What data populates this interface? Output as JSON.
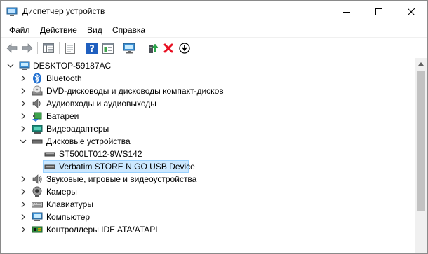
{
  "window": {
    "title": "Диспетчер устройств"
  },
  "menu": {
    "items": [
      {
        "label": "Файл"
      },
      {
        "label": "Действие"
      },
      {
        "label": "Вид"
      },
      {
        "label": "Справка"
      }
    ]
  },
  "toolbar": {
    "buttons": [
      {
        "icon": "back-arrow-icon"
      },
      {
        "icon": "forward-arrow-icon"
      },
      {
        "icon": "show-hide-console-tree-icon"
      },
      {
        "icon": "properties-icon"
      },
      {
        "icon": "help-icon"
      },
      {
        "icon": "action-pane-icon"
      },
      {
        "icon": "scan-hardware-icon"
      },
      {
        "icon": "update-driver-icon"
      },
      {
        "icon": "uninstall-device-icon"
      },
      {
        "icon": "disable-device-icon"
      }
    ]
  },
  "tree": {
    "root": {
      "label": "DESKTOP-59187AC",
      "expanded": true
    },
    "items": [
      {
        "label": "Bluetooth",
        "icon": "bluetooth-icon",
        "expanded": false,
        "level": 1
      },
      {
        "label": "DVD-дисководы и дисководы компакт-дисков",
        "icon": "dvd-drive-icon",
        "expanded": false,
        "level": 1
      },
      {
        "label": "Аудиовходы и аудиовыходы",
        "icon": "speaker-icon",
        "expanded": false,
        "level": 1
      },
      {
        "label": "Батареи",
        "icon": "battery-icon",
        "expanded": false,
        "level": 1
      },
      {
        "label": "Видеоадаптеры",
        "icon": "display-adapter-icon",
        "expanded": false,
        "level": 1
      },
      {
        "label": "Дисковые устройства",
        "icon": "disk-drive-icon",
        "expanded": true,
        "level": 1
      },
      {
        "label": "ST500LT012-9WS142",
        "icon": "disk-drive-icon",
        "level": 2
      },
      {
        "label": "Verbatim STORE N GO USB Device",
        "icon": "disk-drive-icon",
        "level": 2,
        "selected": true
      },
      {
        "label": "Звуковые, игровые и видеоустройства",
        "icon": "sound-icon",
        "expanded": false,
        "level": 1
      },
      {
        "label": "Камеры",
        "icon": "camera-icon",
        "expanded": false,
        "level": 1
      },
      {
        "label": "Клавиатуры",
        "icon": "keyboard-icon",
        "expanded": false,
        "level": 1
      },
      {
        "label": "Компьютер",
        "icon": "computer-icon",
        "expanded": false,
        "level": 1
      },
      {
        "label": "Контроллеры IDE ATA/ATAPI",
        "icon": "ide-controller-icon",
        "expanded": false,
        "level": 1
      }
    ]
  },
  "colors": {
    "selection_bg": "#cce8ff",
    "selection_border": "#99d1ff",
    "accent_blue": "#0078d7",
    "uninstall_red": "#e81123"
  }
}
